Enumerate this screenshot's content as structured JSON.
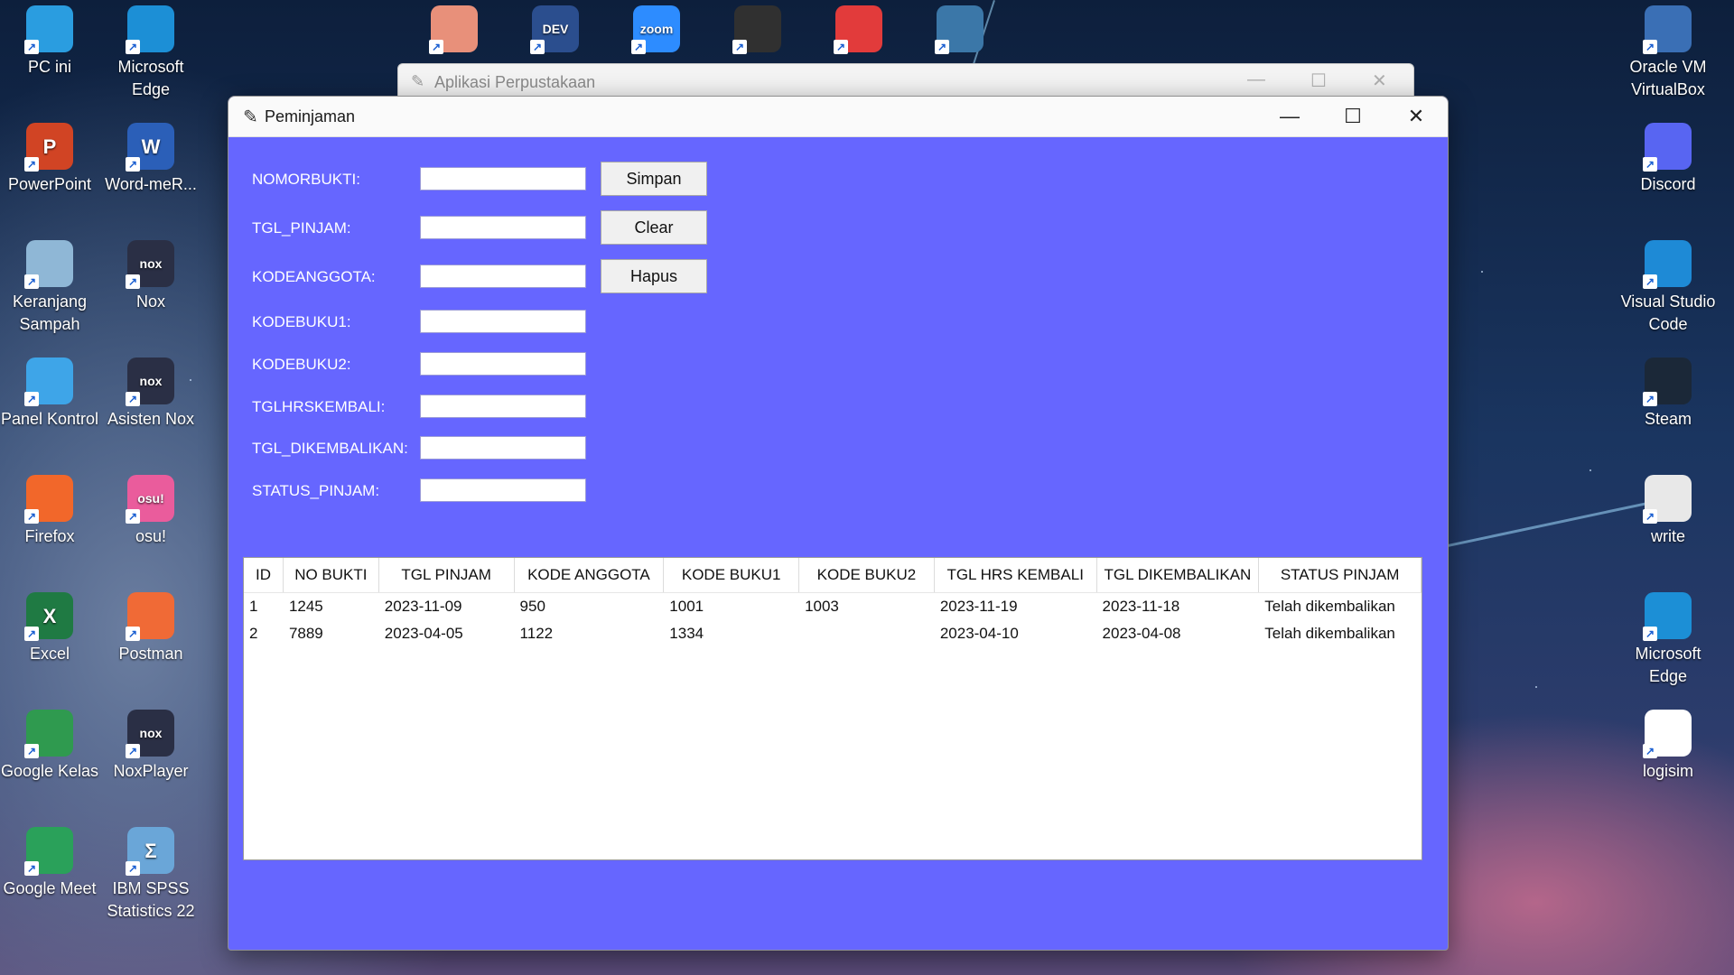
{
  "desktop_left": [
    {
      "label": "PC ini",
      "icon": "monitor-icon",
      "color": "#2a9de0"
    },
    {
      "label": "Microsoft Edge",
      "icon": "edge-icon",
      "color": "#1c8fd6"
    },
    {
      "label": "PowerPoint",
      "icon": "powerpoint-icon",
      "color": "#d14424",
      "glyph": "P"
    },
    {
      "label": "Word-meR...",
      "icon": "word-icon",
      "color": "#2b5fb8",
      "glyph": "W"
    },
    {
      "label": "Keranjang Sampah",
      "icon": "recycle-bin-icon",
      "color": "#8fb7d6"
    },
    {
      "label": "Nox",
      "icon": "nox-icon",
      "color": "#2a2f45",
      "glyph": "nox"
    },
    {
      "label": "Panel Kontrol",
      "icon": "control-panel-icon",
      "color": "#3ea5e8"
    },
    {
      "label": "Asisten Nox",
      "icon": "nox-assistant-icon",
      "color": "#2a2f45",
      "glyph": "nox"
    },
    {
      "label": "Firefox",
      "icon": "firefox-icon",
      "color": "#f2672a"
    },
    {
      "label": "osu!",
      "icon": "osu-icon",
      "color": "#ea5c9c",
      "glyph": "osu!"
    },
    {
      "label": "Excel",
      "icon": "excel-icon",
      "color": "#1f7a43",
      "glyph": "X"
    },
    {
      "label": "Postman",
      "icon": "postman-icon",
      "color": "#f06a36"
    },
    {
      "label": "Google Kelas",
      "icon": "google-classroom-icon",
      "color": "#2f9a4f"
    },
    {
      "label": "NoxPlayer",
      "icon": "noxplayer-icon",
      "color": "#2a2f45",
      "glyph": "nox"
    },
    {
      "label": "Google Meet",
      "icon": "google-meet-icon",
      "color": "#2aa15a"
    },
    {
      "label": "IBM SPSS Statistics 22",
      "icon": "spss-icon",
      "color": "#6aa6d8",
      "glyph": "Σ"
    }
  ],
  "desktop_right": [
    {
      "label": "Oracle VM VirtualBox",
      "icon": "virtualbox-icon",
      "color": "#3a6fb5"
    },
    {
      "label": "Discord",
      "icon": "discord-icon",
      "color": "#5865f2"
    },
    {
      "label": "Visual Studio Code",
      "icon": "vscode-icon",
      "color": "#1e8ad6"
    },
    {
      "label": "Steam",
      "icon": "steam-icon",
      "color": "#1b2838"
    },
    {
      "label": "write",
      "icon": "write-icon",
      "color": "#e8e8e8"
    },
    {
      "label": "Microsoft Edge",
      "icon": "edge-icon",
      "color": "#1c8fd6"
    },
    {
      "label": "logisim",
      "icon": "logisim-icon",
      "color": "#ffffff"
    }
  ],
  "desktop_top_partial": [
    {
      "icon": "flowgorithm-icon",
      "color": "#e8907a"
    },
    {
      "icon": "dev-cpp-icon",
      "color": "#2b4e8e",
      "glyph": "DEV"
    },
    {
      "icon": "zoom-icon",
      "color": "#2d8cff",
      "glyph": "zoom"
    },
    {
      "icon": "obs-studio-icon",
      "color": "#303030"
    },
    {
      "icon": "lenovo-icon",
      "color": "#e23b3b"
    },
    {
      "icon": "python-app-icon",
      "color": "#3b77a8"
    }
  ],
  "bg_window": {
    "title": "Aplikasi Perpustakaan"
  },
  "window": {
    "title": "Peminjaman",
    "controls": {
      "minimize": "—",
      "maximize": "☐",
      "close": "✕"
    }
  },
  "form": {
    "fields": [
      {
        "label": "NOMORBUKTI:",
        "value": ""
      },
      {
        "label": "TGL_PINJAM:",
        "value": ""
      },
      {
        "label": "KODEANGGOTA:",
        "value": ""
      },
      {
        "label": "KODEBUKU1:",
        "value": ""
      },
      {
        "label": "KODEBUKU2:",
        "value": ""
      },
      {
        "label": "TGLHRSKEMBALI:",
        "value": ""
      },
      {
        "label": "TGL_DIKEMBALIKAN:",
        "value": ""
      },
      {
        "label": "STATUS_PINJAM:",
        "value": ""
      }
    ],
    "buttons": {
      "save": "Simpan",
      "clear": "Clear",
      "delete": "Hapus"
    }
  },
  "table": {
    "columns": [
      "ID",
      "NO BUKTI",
      "TGL PINJAM",
      "KODE ANGGOTA",
      "KODE BUKU1",
      "KODE BUKU2",
      "TGL HRS KEMBALI",
      "TGL DIKEMBALIKAN",
      "STATUS PINJAM"
    ],
    "rows": [
      [
        "1",
        "1245",
        "2023-11-09",
        "950",
        "1001",
        "1003",
        "2023-11-19",
        "2023-11-18",
        "Telah dikembalikan"
      ],
      [
        "2",
        "7889",
        "2023-04-05",
        "1122",
        "1334",
        "",
        "2023-04-10",
        "2023-04-08",
        "Telah dikembalikan"
      ]
    ]
  },
  "colors": {
    "window_bg": "#6666ff",
    "titlebar_bg": "#fafafa"
  }
}
